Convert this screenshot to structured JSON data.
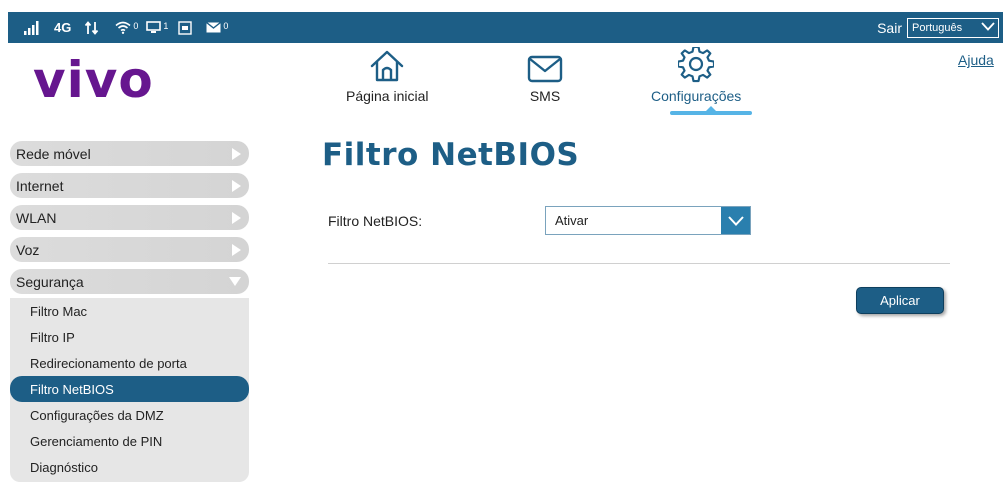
{
  "status_bar": {
    "network_type": "4G",
    "wifi_count": "0",
    "device_count": "1",
    "sms_count": "0",
    "logout_label": "Sair",
    "language_selected": "Português"
  },
  "header": {
    "logo_text": "vivo",
    "help_link": "Ajuda",
    "nav": [
      {
        "label": "Página inicial",
        "icon": "home-icon"
      },
      {
        "label": "SMS",
        "icon": "envelope-icon"
      },
      {
        "label": "Configurações",
        "icon": "gear-icon"
      }
    ],
    "active_nav": "Configurações"
  },
  "sidebar": {
    "items": [
      {
        "label": "Rede móvel"
      },
      {
        "label": "Internet"
      },
      {
        "label": "WLAN"
      },
      {
        "label": "Voz"
      },
      {
        "label": "Segurança"
      }
    ],
    "expanded": "Segurança",
    "subitems": [
      {
        "label": "Filtro Mac"
      },
      {
        "label": "Filtro IP"
      },
      {
        "label": "Redirecionamento de porta"
      },
      {
        "label": "Filtro NetBIOS"
      },
      {
        "label": "Configurações da DMZ"
      },
      {
        "label": "Gerenciamento de PIN"
      },
      {
        "label": "Diagnóstico"
      }
    ],
    "active_subitem": "Filtro NetBIOS"
  },
  "main": {
    "title": "Filtro NetBIOS",
    "field_label": "Filtro NetBIOS:",
    "field_value": "Ativar",
    "apply_label": "Aplicar"
  },
  "colors": {
    "brand_blue": "#1d5e86",
    "logo_purple": "#66168f",
    "accent_light_blue": "#56b4e6",
    "menu_gray": "#d8d8d8"
  }
}
